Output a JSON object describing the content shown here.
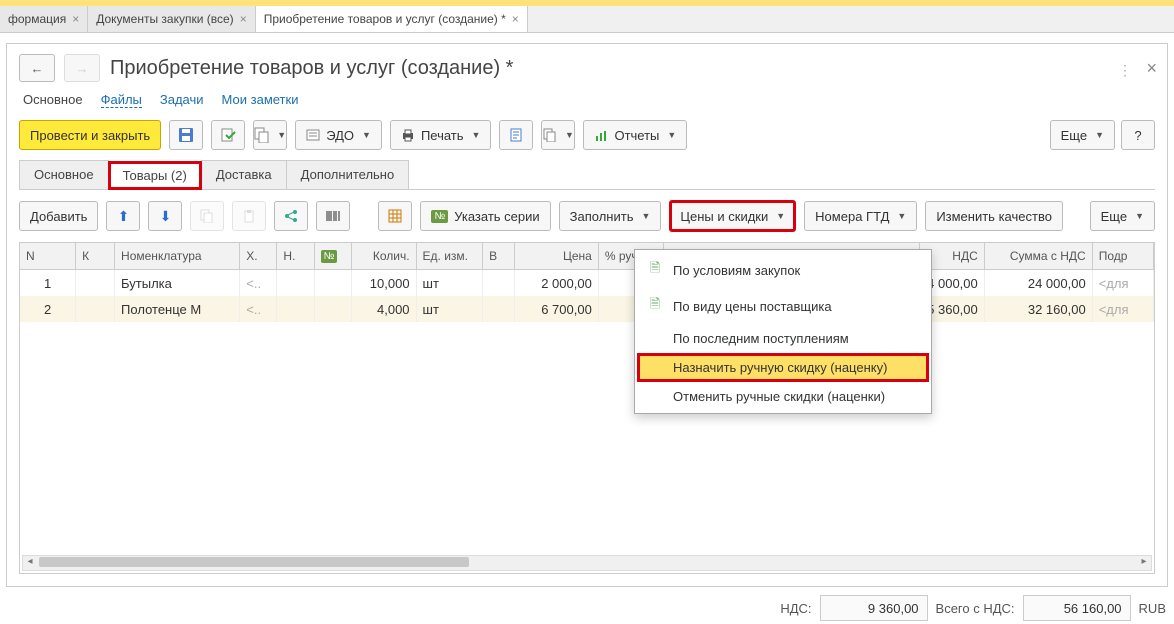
{
  "appTabs": [
    {
      "label": "формация"
    },
    {
      "label": "Документы закупки (все)"
    },
    {
      "label": "Приобретение товаров и услуг (создание) *",
      "active": true
    }
  ],
  "page": {
    "title": "Приобретение товаров и услуг (создание) *"
  },
  "subnav": {
    "main": "Основное",
    "files": "Файлы",
    "tasks": "Задачи",
    "notes": "Мои заметки"
  },
  "toolbar": {
    "post_close": "Провести и закрыть",
    "edo": "ЭДО",
    "print": "Печать",
    "reports": "Отчеты",
    "more": "Еще",
    "help": "?"
  },
  "innerTabs": {
    "main": "Основное",
    "goods": "Товары (2)",
    "delivery": "Доставка",
    "extra": "Дополнительно"
  },
  "subtoolbar": {
    "add": "Добавить",
    "series": "Указать серии",
    "fill": "Заполнить",
    "prices": "Цены и скидки",
    "gtd": "Номера ГТД",
    "quality": "Изменить качество",
    "more": "Еще"
  },
  "gridHeaders": {
    "n": "N",
    "k": "К",
    "nomen": "Номенклатура",
    "x": "Х.",
    "h": "Н.",
    "ne": "№",
    "qty": "Колич.",
    "unit": "Ед. изм.",
    "v": "В",
    "price": "Цена",
    "man": "% руч.",
    "nds": "НДС",
    "sumnds": "Сумма с НДС",
    "podr": "Подр"
  },
  "rows": [
    {
      "n": "1",
      "nomen": "Бутылка",
      "x": "<..",
      "qty": "10,000",
      "unit": "шт",
      "price": "2 000,00",
      "nds": "4 000,00",
      "sumnds": "24 000,00",
      "podr": "<для"
    },
    {
      "n": "2",
      "nomen": "Полотенце М",
      "x": "<..",
      "qty": "4,000",
      "unit": "шт",
      "price": "6 700,00",
      "nds": "5 360,00",
      "sumnds": "32 160,00",
      "podr": "<для"
    }
  ],
  "dropdown": {
    "item1": "По условиям закупок",
    "item2": "По виду цены поставщика",
    "item3": "По последним поступлениям",
    "item4": "Назначить ручную скидку (наценку)",
    "item5": "Отменить ручные скидки (наценки)"
  },
  "footer": {
    "nds_label": "НДС:",
    "nds_value": "9 360,00",
    "total_label": "Всего с НДС:",
    "total_value": "56 160,00",
    "currency": "RUB"
  }
}
